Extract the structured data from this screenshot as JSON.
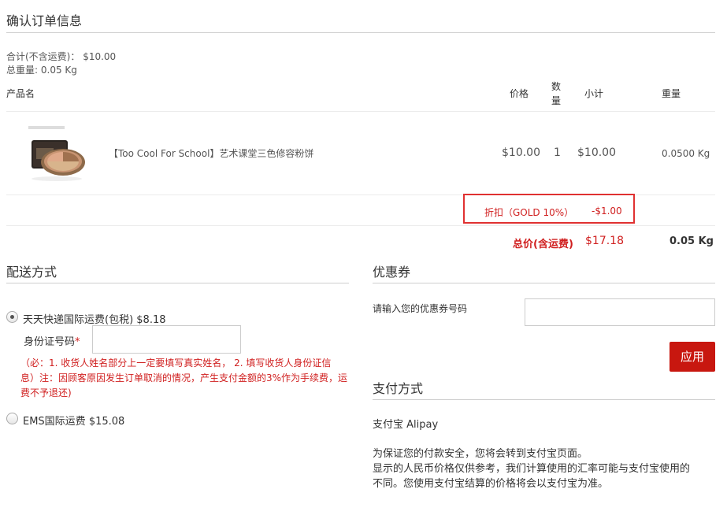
{
  "confirm": {
    "title": "确认订单信息",
    "subtotal_label": "合计(不含运费)：",
    "subtotal_value": "$10.00",
    "weight_label": "总重量:",
    "weight_value": "0.05 Kg"
  },
  "table": {
    "headers": {
      "product": "产品名",
      "price": "价格",
      "qty_line1": "数",
      "qty_line2": "量",
      "subtotal": "小计",
      "weight": "重量"
    },
    "row": {
      "name": "【Too Cool For School】艺术课堂三色修容粉饼",
      "price": "$10.00",
      "qty": "1",
      "subtotal": "$10.00",
      "weight": "0.0500 Kg"
    },
    "discount_label": "折扣（GOLD 10%）",
    "discount_value": "-$1.00",
    "total_label": "总价(含运费)",
    "total_value": "$17.18",
    "total_weight": "0.05 Kg"
  },
  "shipping": {
    "title": "配送方式",
    "option1": "天天快递国际运费(包税) $8.18",
    "id_label": "身份证号码",
    "required_mark": "*",
    "note_line1": "（必：1. 收货人姓名部分上一定要填写真实姓名， 2. 填写收货人身份证信",
    "note_line2": "息）注：因顾客原因发生订单取消的情况，产生支付金额的3%作为手续费，运",
    "note_line3": "费不予退还)",
    "option2": "EMS国际运费 $15.08"
  },
  "coupon": {
    "title": "优惠券",
    "label": "请输入您的优惠券号码",
    "apply": "应用"
  },
  "payment": {
    "title": "支付方式",
    "method": "支付宝 Alipay",
    "line1": "为保证您的付款安全，您将会转到支付宝页面。",
    "line2": "显示的人民币价格仅供参考，我们计算使用的汇率可能与支付宝使用的",
    "line3": "不同。您使用支付宝结算的价格将会以支付宝为准。"
  },
  "colors": {
    "accent": "#c8170f",
    "highlight_border": "#e03131"
  }
}
